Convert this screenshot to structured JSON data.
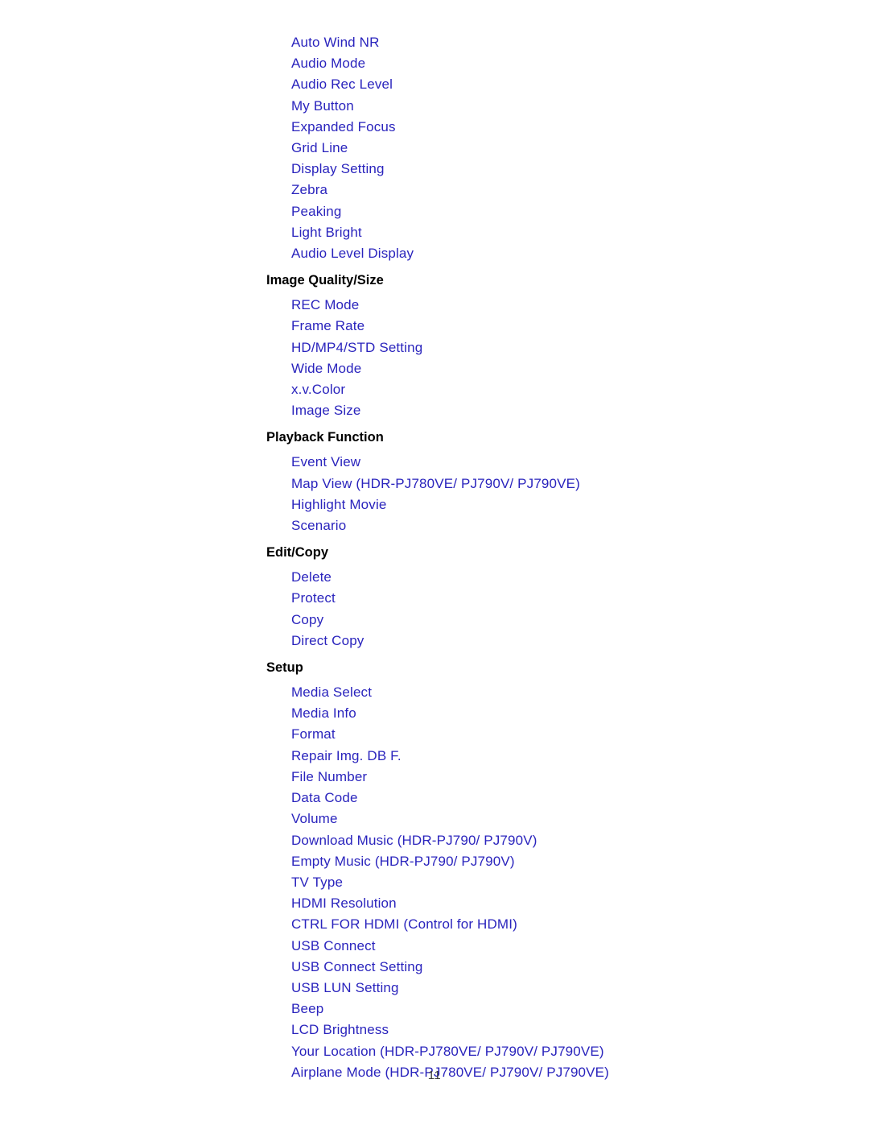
{
  "document": {
    "page_number": "11",
    "link_color": "#2a24bd",
    "header_color": "#000000",
    "background_color": "#ffffff",
    "page_number_color": "#3b3b3b"
  },
  "toc": {
    "sections": [
      {
        "header": null,
        "items": [
          "Auto Wind NR",
          "Audio Mode",
          "Audio Rec Level",
          "My Button",
          "Expanded Focus",
          "Grid Line",
          "Display Setting",
          "Zebra",
          "Peaking",
          "Light Bright",
          "Audio Level Display"
        ]
      },
      {
        "header": "Image Quality/Size",
        "items": [
          "REC Mode",
          "Frame Rate",
          "HD/MP4/STD Setting",
          "Wide Mode",
          "x.v.Color",
          "Image Size"
        ]
      },
      {
        "header": "Playback Function",
        "items": [
          "Event View",
          "Map View (HDR-PJ780VE/ PJ790V/ PJ790VE)",
          "Highlight Movie",
          "Scenario"
        ]
      },
      {
        "header": "Edit/Copy",
        "items": [
          "Delete",
          "Protect",
          "Copy",
          "Direct Copy"
        ]
      },
      {
        "header": "Setup",
        "items": [
          "Media Select",
          "Media Info",
          "Format",
          "Repair Img. DB F.",
          "File Number",
          "Data Code",
          "Volume",
          "Download Music (HDR-PJ790/ PJ790V)",
          "Empty Music (HDR-PJ790/ PJ790V)",
          "TV Type",
          "HDMI Resolution",
          "CTRL FOR HDMI (Control for HDMI)",
          "USB Connect",
          "USB Connect Setting",
          "USB LUN Setting",
          "Beep",
          "LCD Brightness",
          "Your Location (HDR-PJ780VE/ PJ790V/ PJ790VE)",
          "Airplane Mode (HDR-PJ780VE/ PJ790V/ PJ790VE)"
        ]
      }
    ]
  }
}
